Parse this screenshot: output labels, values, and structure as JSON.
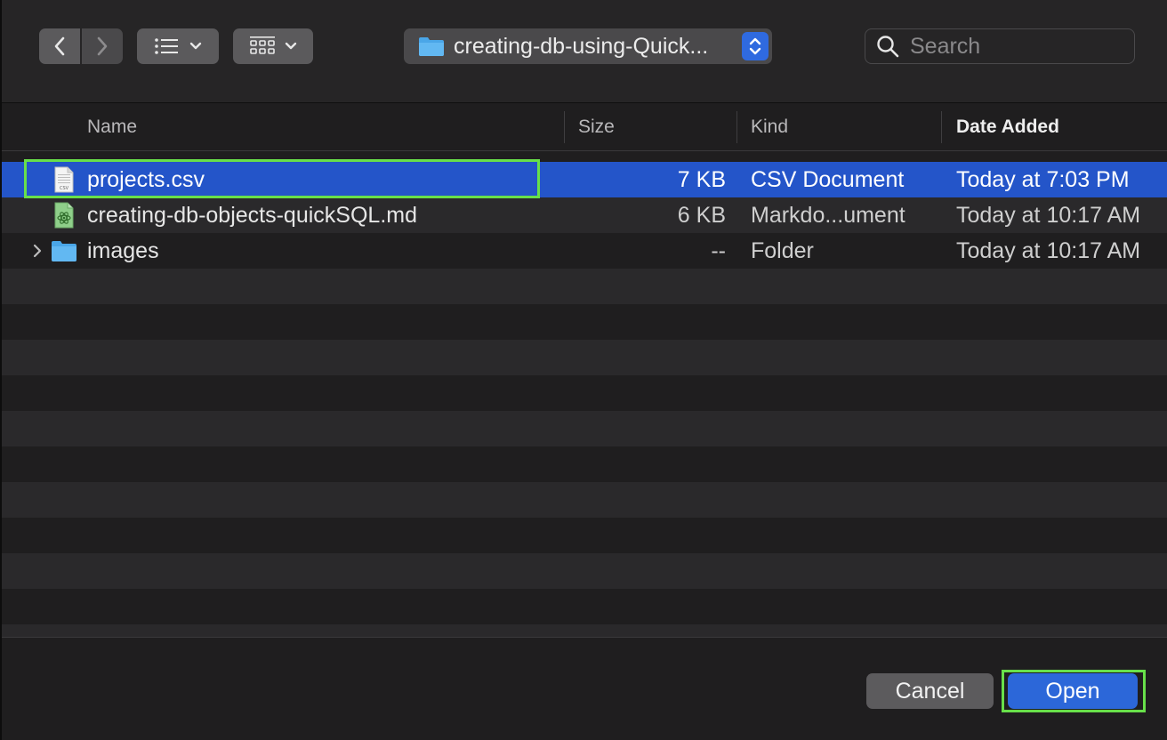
{
  "toolbar": {
    "back_icon": "chevron-left-icon",
    "forward_icon": "chevron-right-icon",
    "list_view_icon": "list-icon",
    "grid_view_icon": "grid-icon",
    "path_label": "creating-db-using-Quick...",
    "search_placeholder": "Search"
  },
  "columns": {
    "name": "Name",
    "size": "Size",
    "kind": "Kind",
    "date_added": "Date Added"
  },
  "files": [
    {
      "name": "projects.csv",
      "size": "7 KB",
      "kind": "CSV Document",
      "date": "Today at 7:03 PM",
      "icon": "csv-file-icon",
      "selected": true
    },
    {
      "name": "creating-db-objects-quickSQL.md",
      "size": "6 KB",
      "kind": "Markdo...ument",
      "date": "Today at 10:17 AM",
      "icon": "markdown-file-icon",
      "selected": false
    },
    {
      "name": "images",
      "size": "--",
      "kind": "Folder",
      "date": "Today at 10:17 AM",
      "icon": "folder-icon",
      "selected": false
    }
  ],
  "footer": {
    "cancel_label": "Cancel",
    "open_label": "Open"
  },
  "colors": {
    "selection": "#2455c9",
    "highlight": "#68e04a",
    "accent": "#2c67d9"
  }
}
